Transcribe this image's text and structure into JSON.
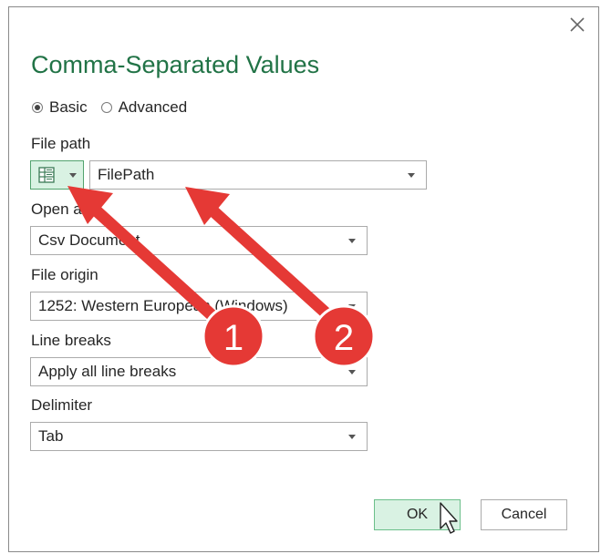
{
  "dialog": {
    "title": "Comma-Separated Values",
    "close_icon": "close-icon"
  },
  "mode": {
    "options": [
      {
        "label": "Basic",
        "selected": true
      },
      {
        "label": "Advanced",
        "selected": false
      }
    ]
  },
  "fields": {
    "file_path_label": "File path",
    "file_path_value": "FilePath",
    "open_as_label": "Open as",
    "open_as_value": "Csv Document",
    "file_origin_label": "File origin",
    "file_origin_value": "1252: Western European (Windows)",
    "line_breaks_label": "Line breaks",
    "line_breaks_value": "Apply all line breaks",
    "delimiter_label": "Delimiter",
    "delimiter_value": "Tab"
  },
  "buttons": {
    "ok": "OK",
    "cancel": "Cancel"
  },
  "annotations": {
    "callout_1": "1",
    "callout_2": "2",
    "color": "#e53935"
  },
  "colors": {
    "title": "#217346",
    "accent_fill": "#d9f2e3",
    "accent_border": "#52a36e"
  }
}
